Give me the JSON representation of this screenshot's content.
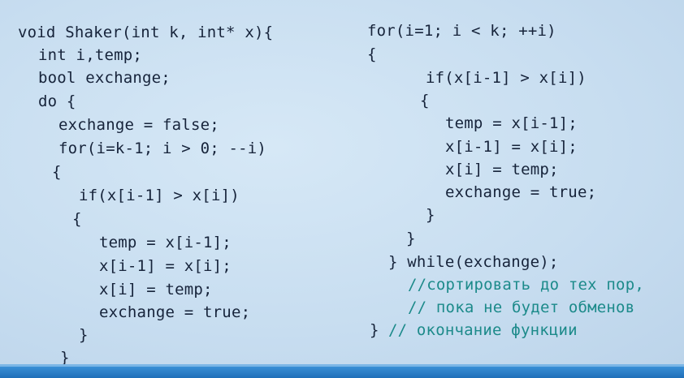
{
  "slide": {
    "left_column": [
      "void Shaker(int k, int* x){",
      "int i,temp;",
      "bool exchange;",
      "do {",
      "exchange = false;",
      "for(i=k-1; i > 0; --i)",
      "{",
      "if(x[i-1] > x[i])",
      "{",
      "temp = x[i-1];",
      "x[i-1] = x[i];",
      "x[i] = temp;",
      "exchange = true;",
      "}",
      "}"
    ],
    "right_column": [
      "for(i=1; i < k; ++i)",
      "{",
      "if(x[i-1] > x[i])",
      "{",
      "temp = x[i-1];",
      "x[i-1] = x[i];",
      "x[i] = temp;",
      "exchange = true;",
      "}",
      "}",
      "} while(exchange);",
      "//сортировать до тех пор,",
      "// пока не будет обменов",
      "}",
      "// окончание функции"
    ]
  },
  "colors": {
    "code_text": "#16233a",
    "comment_text": "#1c8a8a",
    "background": "#c7ddf0",
    "bottom_bar": "#2a7fc8"
  }
}
